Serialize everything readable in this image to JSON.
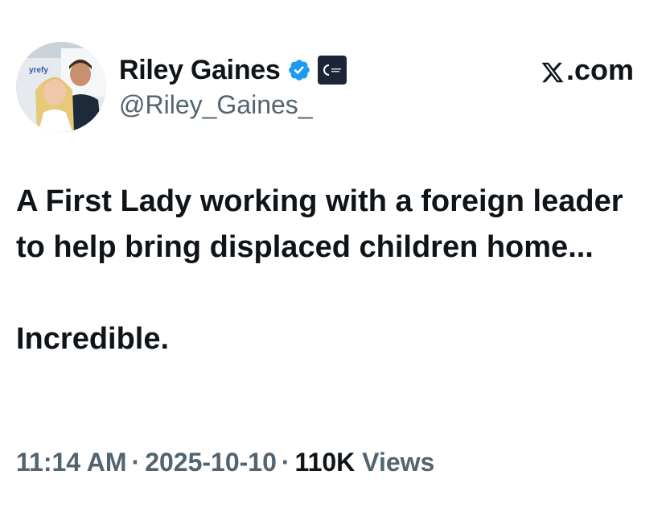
{
  "author": {
    "display_name": "Riley Gaines",
    "handle": "@Riley_Gaines_",
    "verified": true,
    "verified_color": "#1d9bf0",
    "affiliate_badge_color": "#1c2537",
    "avatar_text": "yrefy"
  },
  "brand": {
    "label": ".com",
    "logo_icon": "x-logo-icon"
  },
  "tweet": {
    "lines": [
      "A First Lady working with a foreign leader to help bring displaced children home...",
      "Incredible."
    ]
  },
  "meta": {
    "time": "11:14 AM",
    "separator": "·",
    "date": "2025-10-10",
    "views_count": "110K",
    "views_label": "Views"
  },
  "colors": {
    "primary_text": "#0f1419",
    "secondary_text": "#536471"
  }
}
